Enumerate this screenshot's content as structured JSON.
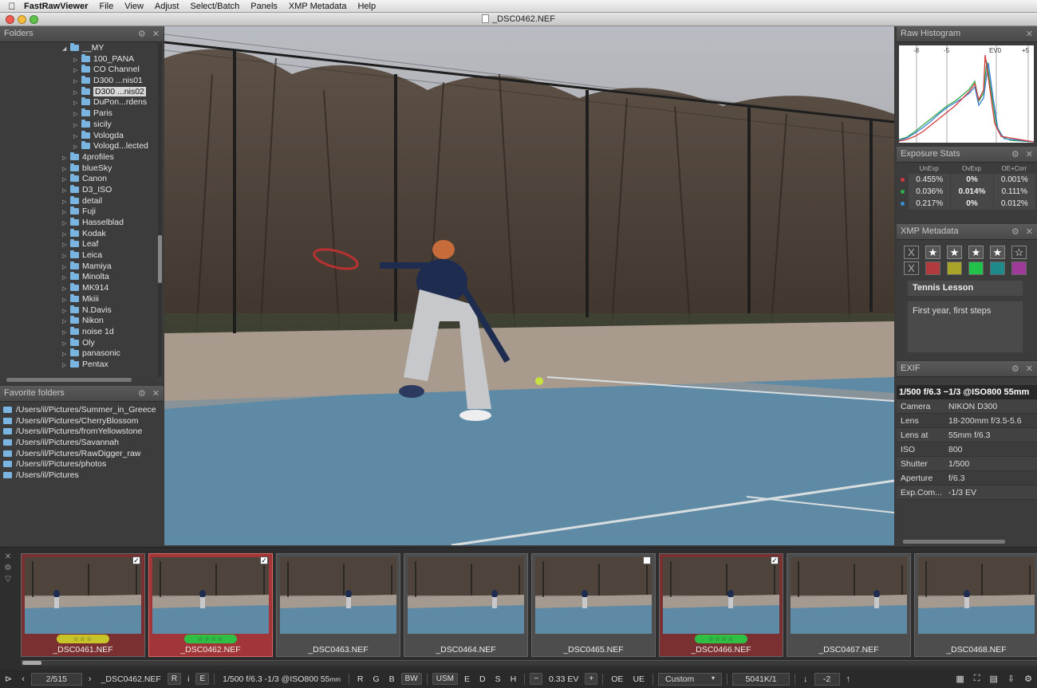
{
  "menubar": {
    "apple": "",
    "app_name": "FastRawViewer",
    "items": [
      "File",
      "View",
      "Adjust",
      "Select/Batch",
      "Panels",
      "XMP Metadata",
      "Help"
    ]
  },
  "window": {
    "title": "_DSC0462.NEF",
    "colors": {
      "close": "#ee5b50",
      "minimize": "#f4bc3b",
      "zoom": "#5fc24a"
    }
  },
  "folders_panel": {
    "title": "Folders",
    "items": [
      {
        "label": "__MY",
        "arrow": "◢",
        "indent": 5
      },
      {
        "label": "100_PANA",
        "arrow": "▷",
        "indent": 6
      },
      {
        "label": "CO Channel",
        "arrow": "▷",
        "indent": 6
      },
      {
        "label": "D300 ...nis01",
        "arrow": "▷",
        "indent": 6
      },
      {
        "label": "D300 ...nis02",
        "arrow": "▷",
        "indent": 6,
        "selected": true
      },
      {
        "label": "DuPon...rdens",
        "arrow": "▷",
        "indent": 6
      },
      {
        "label": "Paris",
        "arrow": "▷",
        "indent": 6
      },
      {
        "label": "sicily",
        "arrow": "▷",
        "indent": 6
      },
      {
        "label": "Vologda",
        "arrow": "▷",
        "indent": 6
      },
      {
        "label": "Vologd...lected",
        "arrow": "▷",
        "indent": 6
      },
      {
        "label": "4profiles",
        "arrow": "▷",
        "indent": 5
      },
      {
        "label": "blueSky",
        "arrow": "▷",
        "indent": 5
      },
      {
        "label": "Canon",
        "arrow": "▷",
        "indent": 5
      },
      {
        "label": "D3_ISO",
        "arrow": "▷",
        "indent": 5
      },
      {
        "label": "detail",
        "arrow": "▷",
        "indent": 5
      },
      {
        "label": "Fuji",
        "arrow": "▷",
        "indent": 5
      },
      {
        "label": "Hasselblad",
        "arrow": "▷",
        "indent": 5
      },
      {
        "label": "Kodak",
        "arrow": "▷",
        "indent": 5
      },
      {
        "label": "Leaf",
        "arrow": "▷",
        "indent": 5
      },
      {
        "label": "Leica",
        "arrow": "▷",
        "indent": 5
      },
      {
        "label": "Mamiya",
        "arrow": "▷",
        "indent": 5
      },
      {
        "label": "Minolta",
        "arrow": "▷",
        "indent": 5
      },
      {
        "label": "MK914",
        "arrow": "▷",
        "indent": 5
      },
      {
        "label": "Mkiii",
        "arrow": "▷",
        "indent": 5
      },
      {
        "label": "N.Davis",
        "arrow": "▷",
        "indent": 5
      },
      {
        "label": "Nikon",
        "arrow": "▷",
        "indent": 5
      },
      {
        "label": "noise 1d",
        "arrow": "▷",
        "indent": 5
      },
      {
        "label": "Oly",
        "arrow": "▷",
        "indent": 5
      },
      {
        "label": "panasonic",
        "arrow": "▷",
        "indent": 5
      },
      {
        "label": "Pentax",
        "arrow": "▷",
        "indent": 5
      }
    ]
  },
  "favorites_panel": {
    "title": "Favorite folders",
    "items": [
      "/Users/il/Pictures/Summer_in_Greece",
      "/Users/il/Pictures/CherryBlossom",
      "/Users/il/Pictures/fromYellowstone",
      "/Users/il/Pictures/Savannah",
      "/Users/il/Pictures/RawDigger_raw",
      "/Users/il/Pictures/photos",
      "/Users/il/Pictures"
    ]
  },
  "histogram_panel": {
    "title": "Raw Histogram",
    "ticks": [
      "-8",
      "-5",
      "EV0",
      "+5"
    ]
  },
  "exposure_panel": {
    "title": "Exposure Stats",
    "headers": [
      "UnExp",
      "OvExp",
      "OE+Corr"
    ],
    "rows": [
      {
        "channel": "R",
        "color": "#d23a3a",
        "values": [
          "0.455%",
          "0%",
          "0.001%"
        ]
      },
      {
        "channel": "G",
        "color": "#2fb04a",
        "values": [
          "0.036%",
          "0.014%",
          "0.111%"
        ]
      },
      {
        "channel": "B",
        "color": "#3a8fd2",
        "values": [
          "0.217%",
          "0%",
          "0.012%"
        ]
      }
    ]
  },
  "xmp_panel": {
    "title": "XMP Metadata",
    "reject": "X",
    "stars": [
      "★",
      "★",
      "★",
      "★",
      "☆"
    ],
    "no_label": "X",
    "labels": [
      "#b03a3e",
      "#a9a32a",
      "#22c24a",
      "#1e8a8a",
      "#a03a9a"
    ],
    "title_value": "Tennis Lesson",
    "description": "First year, first steps"
  },
  "exif_panel": {
    "title": "EXIF",
    "summary": "1/500 f/6.3 −1/3 @ISO800 55mm",
    "rows": [
      {
        "key": "Camera",
        "value": "NIKON D300"
      },
      {
        "key": "Lens",
        "value": "18-200mm f/3.5-5.6"
      },
      {
        "key": "Lens at",
        "value": "55mm f/6.3"
      },
      {
        "key": "ISO",
        "value": "800"
      },
      {
        "key": "Shutter",
        "value": "1/500"
      },
      {
        "key": "Aperture",
        "value": "f/6.3"
      },
      {
        "key": "Exp.Com...",
        "value": "-1/3 EV"
      }
    ]
  },
  "filmstrip": {
    "thumbs": [
      {
        "name": "_DSC0461.NEF",
        "state": "picked",
        "rating": "☆☆☆",
        "rating_color": "#c7c42a",
        "checked": true
      },
      {
        "name": "_DSC0462.NEF",
        "state": "current",
        "rating": "☆☆☆☆",
        "rating_color": "#2fbf45",
        "checked": true
      },
      {
        "name": "_DSC0463.NEF",
        "state": "normal",
        "rating": "",
        "checked": false
      },
      {
        "name": "_DSC0464.NEF",
        "state": "normal",
        "rating": "",
        "checked": false
      },
      {
        "name": "_DSC0465.NEF",
        "state": "normal",
        "rating": "",
        "checked": false,
        "box": true
      },
      {
        "name": "_DSC0466.NEF",
        "state": "picked",
        "rating": "☆☆☆☆",
        "rating_color": "#2fbf45",
        "checked": true
      },
      {
        "name": "_DSC0467.NEF",
        "state": "normal",
        "rating": "",
        "checked": false
      },
      {
        "name": "_DSC0468.NEF",
        "state": "normal",
        "rating": "",
        "checked": false
      }
    ]
  },
  "toolbar": {
    "counter": "2/515",
    "filename": "_DSC0462.NEF",
    "r_btn": "R",
    "i_btn": "i",
    "e_btn": "E",
    "exif_short": "1/500 f/6.3 -1/3 @ISO800 55",
    "exif_unit": "mm",
    "ch_r": "R",
    "ch_g": "G",
    "ch_b": "B",
    "ch_bw": "BW",
    "usm": "USM",
    "e2": "E",
    "d": "D",
    "s": "S",
    "h": "H",
    "minus": "−",
    "ev": "0.33 EV",
    "plus": "+",
    "oe": "OE",
    "ue": "UE",
    "profile": "Custom",
    "wb": "5041K/1",
    "down_arrow": "↓",
    "tint": "-2",
    "up_arrow": "↑"
  }
}
